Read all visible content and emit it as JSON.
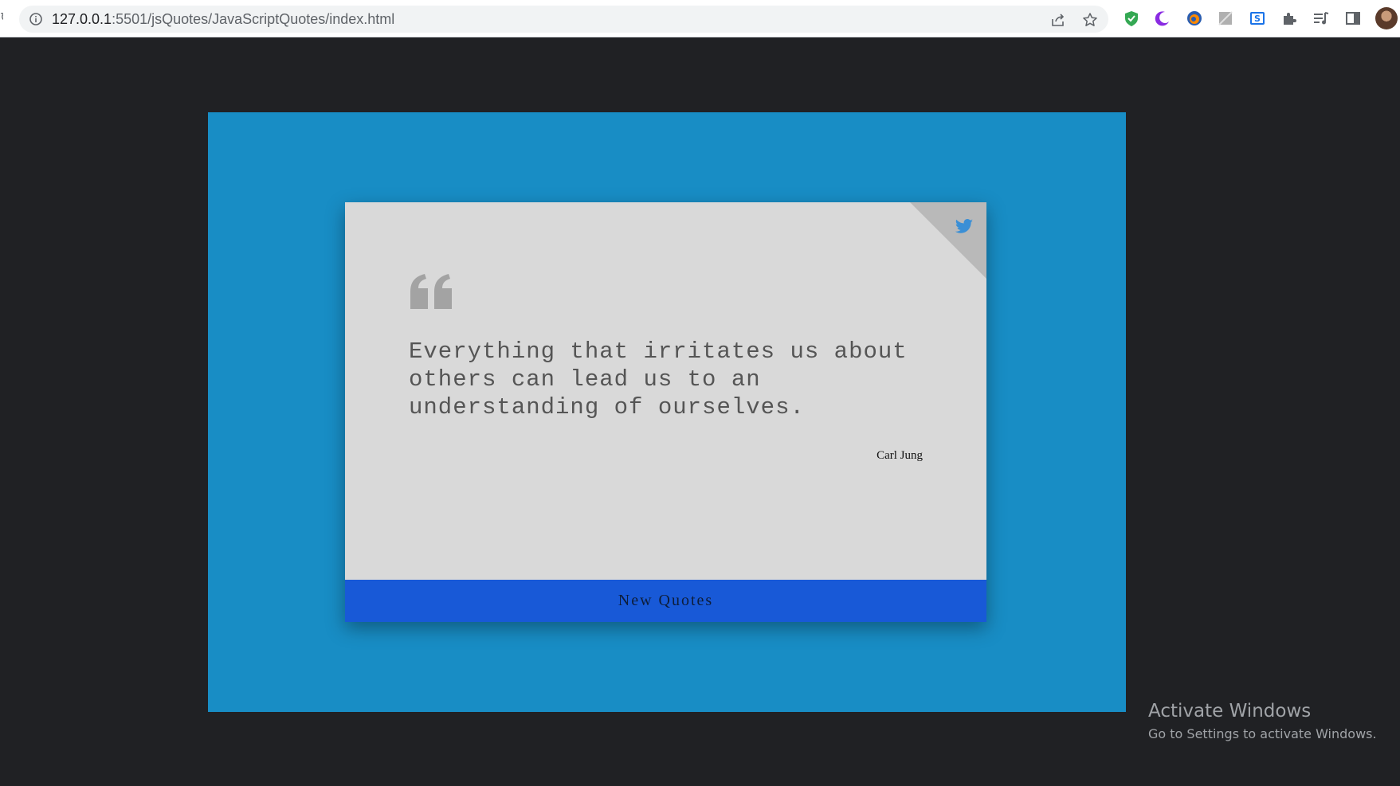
{
  "browser": {
    "url_host": "127.0.0.1",
    "url_rest": ":5501/jsQuotes/JavaScriptQuotes/index.html",
    "icons": [
      "info-icon",
      "share-icon",
      "star-icon",
      "shield-extension-icon",
      "moon-extension-icon",
      "firefox-extension-icon",
      "gray-extension-icon",
      "s-extension-icon",
      "puzzle-icon",
      "media-icon",
      "side-panel-icon",
      "profile-avatar"
    ]
  },
  "card": {
    "quote": "Everything that irritates us about others can lead us to an understanding of ourselves.",
    "author": "Carl Jung",
    "button_label": "New Quotes",
    "icons": [
      "quote-mark-icon",
      "twitter-icon"
    ]
  },
  "colors": {
    "page_bg": "#202124",
    "stage_bg": "#188dc5",
    "card_bg": "#d9d9d9",
    "button_bg": "#1859d7",
    "twitter_blue": "#3a8fd6"
  },
  "watermark": {
    "title": "Activate Windows",
    "subtitle": "Go to Settings to activate Windows."
  }
}
